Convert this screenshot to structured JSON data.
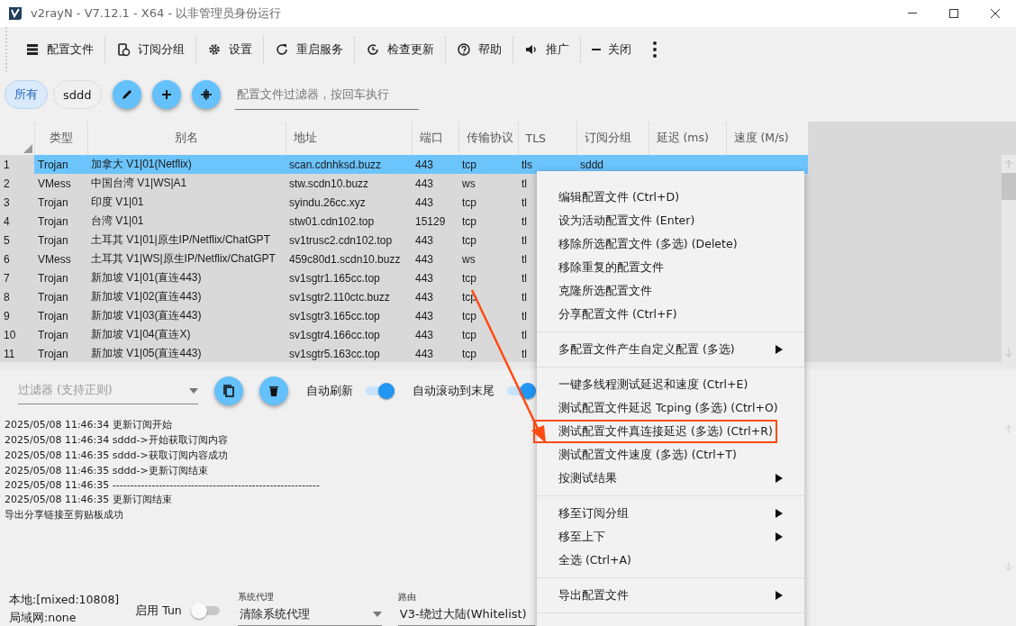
{
  "window": {
    "title": "v2rayN - V7.12.1 - X64 - 以非管理员身份运行"
  },
  "toolbar": [
    "配置文件",
    "订阅分组",
    "设置",
    "重启服务",
    "检查更新",
    "帮助",
    "推广",
    "关闭"
  ],
  "groups": [
    {
      "label": "所有",
      "selected": true
    },
    {
      "label": "sddd",
      "selected": false
    }
  ],
  "profile_filter": {
    "placeholder": "配置文件过滤器，按回车执行"
  },
  "table": {
    "columns": [
      "类型",
      "别名",
      "地址",
      "端口",
      "传输协议",
      "TLS",
      "订阅分组",
      "延迟 (ms)",
      "速度 (M/s)"
    ],
    "rows": [
      {
        "index": "1",
        "selected": true,
        "cells": [
          "Trojan",
          "加拿大 V1|01(Netflix)",
          "scan.cdnhksd.buzz",
          "443",
          "tcp",
          "tls",
          "sddd"
        ]
      },
      {
        "index": "2",
        "selected": false,
        "cells": [
          "VMess",
          "中国台湾 V1|WS|A1",
          "stw.scdn10.buzz",
          "443",
          "ws",
          "tl"
        ]
      },
      {
        "index": "3",
        "selected": false,
        "cells": [
          "Trojan",
          "印度 V1|01",
          "syindu.26cc.xyz",
          "443",
          "tcp",
          "tl"
        ]
      },
      {
        "index": "4",
        "selected": false,
        "cells": [
          "Trojan",
          "台湾 V1|01",
          "stw01.cdn102.top",
          "15129",
          "tcp",
          "tl"
        ]
      },
      {
        "index": "5",
        "selected": false,
        "cells": [
          "Trojan",
          "土耳其 V1|01|原生IP/Netflix/ChatGPT",
          "sv1trusc2.cdn102.top",
          "443",
          "tcp",
          "tl"
        ]
      },
      {
        "index": "6",
        "selected": false,
        "cells": [
          "VMess",
          "土耳其 V1|WS|原生IP/Netflix/ChatGPT",
          "459c80d1.scdn10.buzz",
          "443",
          "ws",
          "tl"
        ]
      },
      {
        "index": "7",
        "selected": false,
        "cells": [
          "Trojan",
          "新加坡 V1|01(直连443)",
          "sv1sgtr1.165cc.top",
          "443",
          "tcp",
          "tl"
        ]
      },
      {
        "index": "8",
        "selected": false,
        "cells": [
          "Trojan",
          "新加坡 V1|02(直连443)",
          "sv1sgtr2.110ctc.buzz",
          "443",
          "tcp",
          "tl"
        ]
      },
      {
        "index": "9",
        "selected": false,
        "cells": [
          "Trojan",
          "新加坡 V1|03(直连443)",
          "sv1sgtr3.165cc.top",
          "443",
          "tcp",
          "tl"
        ]
      },
      {
        "index": "10",
        "selected": false,
        "cells": [
          "Trojan",
          "新加坡 V1|04(直连X)",
          "sv1sgtr4.166cc.top",
          "443",
          "tcp",
          "tl"
        ]
      },
      {
        "index": "11",
        "selected": false,
        "cells": [
          "Trojan",
          "新加坡 V1|05(直连443)",
          "sv1sgtr5.163cc.top",
          "443",
          "tcp",
          "tl"
        ]
      }
    ]
  },
  "log": {
    "filter_placeholder": "过滤器 (支持正则)",
    "auto_refresh": {
      "label": "自动刷新",
      "on": true
    },
    "auto_scroll": {
      "label": "自动滚动到末尾",
      "on": true
    },
    "lines": [
      "2025/05/08 11:46:34 更新订阅开始",
      "2025/05/08 11:46:34 sddd->开始获取订阅内容",
      "2025/05/08 11:46:35 sddd->获取订阅内容成功",
      "2025/05/08 11:46:35 sddd->更新订阅结束",
      "2025/05/08 11:46:35 ----------------------------------------------------------",
      "2025/05/08 11:46:35 更新订阅结束",
      "导出分享链接至剪贴板成功"
    ]
  },
  "status_bar": {
    "local": "本地:[mixed:10808]",
    "lan": "局域网:none",
    "tun": {
      "label": "启用 Tun",
      "on": false
    },
    "system_proxy": {
      "label": "系统代理",
      "value": "清除系统代理"
    },
    "routing": {
      "label": "路由",
      "value": "V3-绕过大陆(Whitelist)"
    }
  },
  "context_menu": [
    [
      {
        "label": "编辑配置文件 (Ctrl+D)",
        "submenu": false,
        "annotated": false
      },
      {
        "label": "设为活动配置文件 (Enter)",
        "submenu": false,
        "annotated": false
      },
      {
        "label": "移除所选配置文件 (多选) (Delete)",
        "submenu": false,
        "annotated": false
      },
      {
        "label": "移除重复的配置文件",
        "submenu": false,
        "annotated": false
      },
      {
        "label": "克隆所选配置文件",
        "submenu": false,
        "annotated": false
      },
      {
        "label": "分享配置文件 (Ctrl+F)",
        "submenu": false,
        "annotated": false
      }
    ],
    [
      {
        "label": "多配置文件产生自定义配置 (多选)",
        "submenu": true,
        "annotated": false
      }
    ],
    [
      {
        "label": "一键多线程测试延迟和速度 (Ctrl+E)",
        "submenu": false,
        "annotated": false
      },
      {
        "label": "测试配置文件延迟 Tcping (多选) (Ctrl+O)",
        "submenu": false,
        "annotated": false
      },
      {
        "label": "测试配置文件真连接延迟 (多选) (Ctrl+R)",
        "submenu": false,
        "annotated": true
      },
      {
        "label": "测试配置文件速度 (多选) (Ctrl+T)",
        "submenu": false,
        "annotated": false
      },
      {
        "label": "按测试结果",
        "submenu": true,
        "annotated": false
      }
    ],
    [
      {
        "label": "移至订阅分组",
        "submenu": true,
        "annotated": false
      },
      {
        "label": "移至上下",
        "submenu": true,
        "annotated": false
      },
      {
        "label": "全选 (Ctrl+A)",
        "submenu": false,
        "annotated": false
      }
    ],
    [
      {
        "label": "导出配置文件",
        "submenu": true,
        "annotated": false
      }
    ]
  ]
}
